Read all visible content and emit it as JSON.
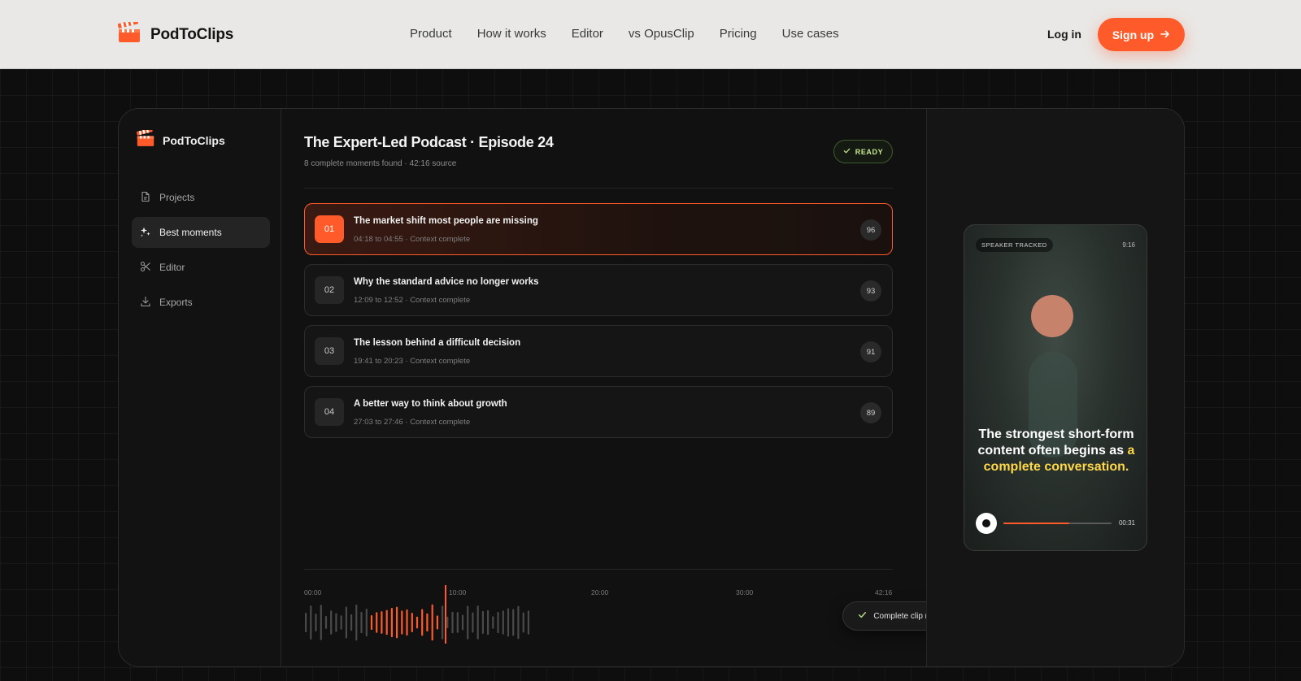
{
  "nav": {
    "brand": "PodToClips",
    "links": [
      "Product",
      "How it works",
      "Editor",
      "vs OpusClip",
      "Pricing",
      "Use cases"
    ],
    "login": "Log in",
    "signup": "Sign up"
  },
  "sidebar": {
    "brand": "PodToClips",
    "items": [
      {
        "label": "Projects",
        "icon": "file-icon"
      },
      {
        "label": "Best moments",
        "icon": "sparkles-icon"
      },
      {
        "label": "Editor",
        "icon": "scissors-icon"
      },
      {
        "label": "Exports",
        "icon": "download-icon"
      }
    ],
    "active": "Best moments"
  },
  "episode": {
    "title": "The Expert-Led Podcast · Episode 24",
    "subtitle": "8 complete moments found · 42:16 source",
    "status": "READY"
  },
  "moments": [
    {
      "num": "01",
      "title": "The market shift most people are missing",
      "meta": "04:18 to 04:55 · Context complete",
      "score": "96"
    },
    {
      "num": "02",
      "title": "Why the standard advice no longer works",
      "meta": "12:09 to 12:52 · Context complete",
      "score": "93"
    },
    {
      "num": "03",
      "title": "The lesson behind a difficult decision",
      "meta": "19:41 to 20:23 · Context complete",
      "score": "91"
    },
    {
      "num": "04",
      "title": "A better way to think about growth",
      "meta": "27:03 to 27:46 · Context complete",
      "score": "89"
    }
  ],
  "timeline": {
    "ticks": [
      "00:00",
      "10:00",
      "20:00",
      "30:00",
      "42:16"
    ],
    "toast": "Complete clip ready"
  },
  "preview": {
    "badge": "SPEAKER TRACKED",
    "ratio": "9:16",
    "caption_plain": "The strongest short-form content often begins as ",
    "caption_highlight": "a complete conversation.",
    "time": "00:31",
    "progress": 0.61
  },
  "colors": {
    "accent": "#ff5a2a",
    "ready_green": "#c9e98f",
    "caption_highlight": "#ffd84a"
  }
}
